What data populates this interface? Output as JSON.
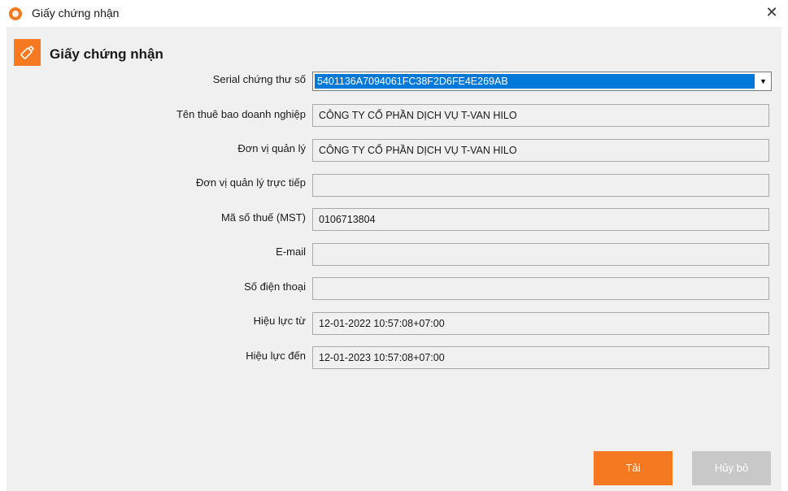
{
  "window": {
    "title": "Giấy chứng nhận",
    "close_glyph": "✕"
  },
  "header": {
    "title": "Giấy chứng nhận",
    "icon": "usb-token-icon"
  },
  "form": {
    "serial_label": "Serial chứng thư số",
    "serial_value": "5401136A7094061FC38F2D6FE4E269AB",
    "subscriber_label": "Tên thuê bao doanh nghiệp",
    "subscriber_value": "CÔNG TY CỔ PHẦN DỊCH VỤ T-VAN HILO",
    "org_label": "Đơn vị quản lý",
    "org_value": "CÔNG TY CỔ PHẦN DỊCH VỤ T-VAN HILO",
    "direct_org_label": "Đơn vị quản lý trực tiếp",
    "direct_org_value": "",
    "tax_label": "Mã số thuế (MST)",
    "tax_value": "0106713804",
    "email_label": "E-mail",
    "email_value": "",
    "phone_label": "Số điện thoại",
    "phone_value": "",
    "valid_from_label": "Hiệu lực từ",
    "valid_from_value": "12-01-2022 10:57:08+07:00",
    "valid_to_label": "Hiệu lực đến",
    "valid_to_value": "12-01-2023 10:57:08+07:00"
  },
  "buttons": {
    "load_label": "Tải",
    "cancel_label": "Hủy bỏ"
  },
  "colors": {
    "accent": "#f47920",
    "selection": "#0078d7",
    "disabled_button": "#c8c8c8"
  }
}
